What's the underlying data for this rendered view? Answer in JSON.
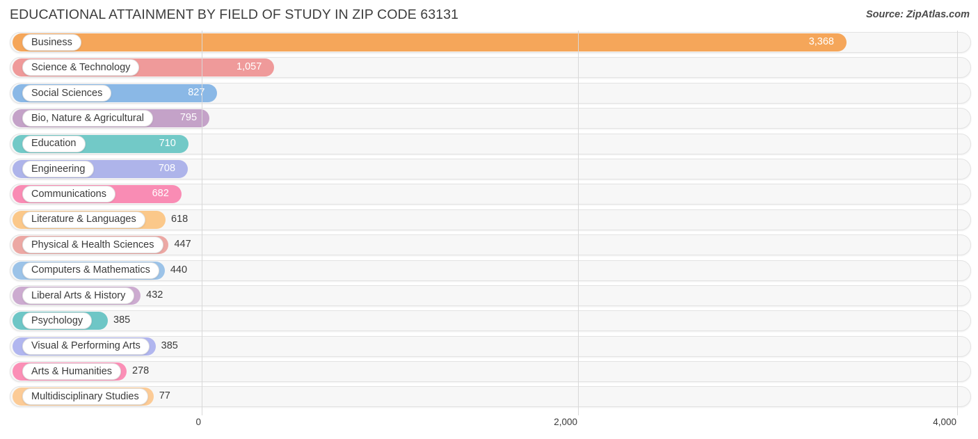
{
  "header": {
    "title": "EDUCATIONAL ATTAINMENT BY FIELD OF STUDY IN ZIP CODE 63131",
    "source": "Source: ZipAtlas.com"
  },
  "chart_data": {
    "type": "bar",
    "orientation": "horizontal",
    "title": "EDUCATIONAL ATTAINMENT BY FIELD OF STUDY IN ZIP CODE 63131",
    "xlabel": "",
    "ylabel": "",
    "xlim": [
      0,
      4000
    ],
    "grid": true,
    "legend": "none",
    "ticks": [
      "0",
      "2,000",
      "4,000"
    ],
    "tick_values": [
      0,
      2000,
      4000
    ],
    "categories": [
      "Business",
      "Science & Technology",
      "Social Sciences",
      "Bio, Nature & Agricultural",
      "Education",
      "Engineering",
      "Communications",
      "Literature & Languages",
      "Physical & Health Sciences",
      "Computers & Mathematics",
      "Liberal Arts & History",
      "Psychology",
      "Visual & Performing Arts",
      "Arts & Humanities",
      "Multidisciplinary Studies"
    ],
    "values": [
      3368,
      1057,
      827,
      795,
      710,
      708,
      682,
      618,
      447,
      440,
      432,
      385,
      385,
      278,
      77
    ],
    "value_labels": [
      "3,368",
      "1,057",
      "827",
      "795",
      "710",
      "708",
      "682",
      "618",
      "447",
      "440",
      "432",
      "385",
      "385",
      "278",
      "77"
    ],
    "colors": [
      "#f5a65a",
      "#ef9a9a",
      "#8ab8e6",
      "#c4a2c8",
      "#72c9c7",
      "#aeb4ea",
      "#f98cb4",
      "#fbc88a",
      "#eca8a4",
      "#9cc3e8",
      "#ccabd0",
      "#6ec6c6",
      "#b1b6ef",
      "#fb8fb6",
      "#fccb96"
    ]
  },
  "axis": {
    "ticks": [
      {
        "label": "0",
        "x": 285
      },
      {
        "label": "2,000",
        "x": 826
      },
      {
        "label": "4,000",
        "x": 1371
      }
    ],
    "gridlines": [
      290,
      831,
      1376
    ]
  }
}
